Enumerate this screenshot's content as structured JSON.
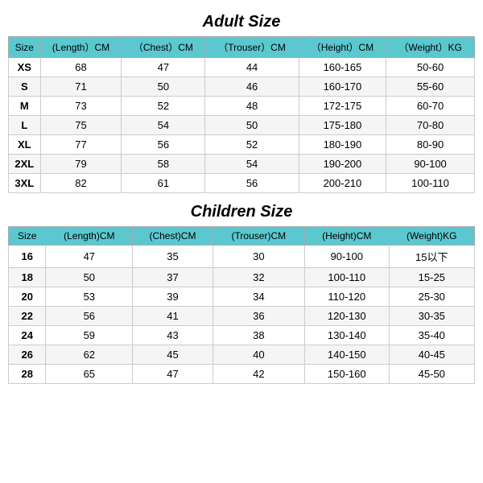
{
  "adult": {
    "title": "Adult Size",
    "headers": [
      "Size",
      "(Length）CM",
      "（Chest）CM",
      "（Trouser）CM",
      "（Height）CM",
      "（Weight）KG"
    ],
    "rows": [
      [
        "XS",
        "68",
        "47",
        "44",
        "160-165",
        "50-60"
      ],
      [
        "S",
        "71",
        "50",
        "46",
        "160-170",
        "55-60"
      ],
      [
        "M",
        "73",
        "52",
        "48",
        "172-175",
        "60-70"
      ],
      [
        "L",
        "75",
        "54",
        "50",
        "175-180",
        "70-80"
      ],
      [
        "XL",
        "77",
        "56",
        "52",
        "180-190",
        "80-90"
      ],
      [
        "2XL",
        "79",
        "58",
        "54",
        "190-200",
        "90-100"
      ],
      [
        "3XL",
        "82",
        "61",
        "56",
        "200-210",
        "100-110"
      ]
    ]
  },
  "children": {
    "title": "Children Size",
    "headers": [
      "Size",
      "(Length)CM",
      "(Chest)CM",
      "(Trouser)CM",
      "(Height)CM",
      "(Weight)KG"
    ],
    "rows": [
      [
        "16",
        "47",
        "35",
        "30",
        "90-100",
        "15以下"
      ],
      [
        "18",
        "50",
        "37",
        "32",
        "100-110",
        "15-25"
      ],
      [
        "20",
        "53",
        "39",
        "34",
        "110-120",
        "25-30"
      ],
      [
        "22",
        "56",
        "41",
        "36",
        "120-130",
        "30-35"
      ],
      [
        "24",
        "59",
        "43",
        "38",
        "130-140",
        "35-40"
      ],
      [
        "26",
        "62",
        "45",
        "40",
        "140-150",
        "40-45"
      ],
      [
        "28",
        "65",
        "47",
        "42",
        "150-160",
        "45-50"
      ]
    ]
  }
}
